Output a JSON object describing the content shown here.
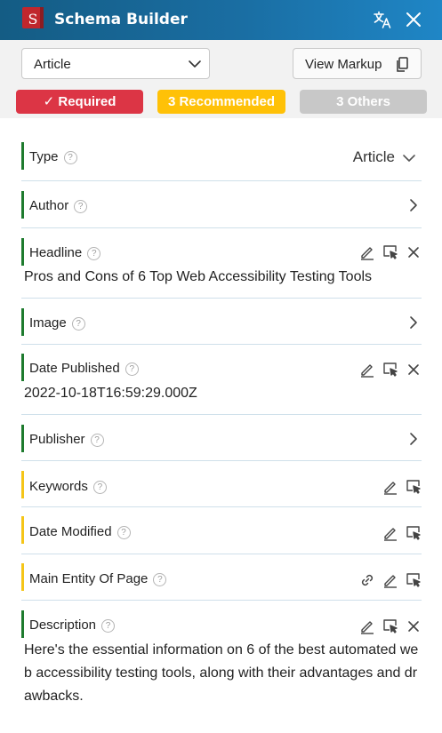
{
  "header": {
    "logo_letter": "S",
    "title": "Schema Builder",
    "translate_icon": "translate-icon",
    "close_icon": "close-icon"
  },
  "toolbar": {
    "schema_select_value": "Article",
    "view_markup_label": "View Markup"
  },
  "filters": {
    "required_label": "✓ Required",
    "recommended_label": "3 Recommended",
    "others_label": "3 Others"
  },
  "colors": {
    "required": "#dc3545",
    "recommended": "#ffc107",
    "others": "#c8c8c8",
    "required_bar": "#1e7b2e",
    "recommended_bar": "#f5c518"
  },
  "properties": [
    {
      "name": "Type",
      "level": "required",
      "type_value": "Article"
    },
    {
      "name": "Author",
      "level": "required"
    },
    {
      "name": "Headline",
      "level": "required",
      "value": "Pros and Cons of 6 Top Web Accessibility Testing Tools"
    },
    {
      "name": "Image",
      "level": "required"
    },
    {
      "name": "Date Published",
      "level": "required",
      "value": "2022-10-18T16:59:29.000Z"
    },
    {
      "name": "Publisher",
      "level": "required"
    },
    {
      "name": "Keywords",
      "level": "recommended"
    },
    {
      "name": "Date Modified",
      "level": "recommended"
    },
    {
      "name": "Main Entity Of Page",
      "level": "recommended"
    },
    {
      "name": "Description",
      "level": "required",
      "value": "Here's the essential information on 6 of the best automated web accessibility testing tools, along with their advantages and drawbacks."
    }
  ],
  "help_glyph": "?"
}
